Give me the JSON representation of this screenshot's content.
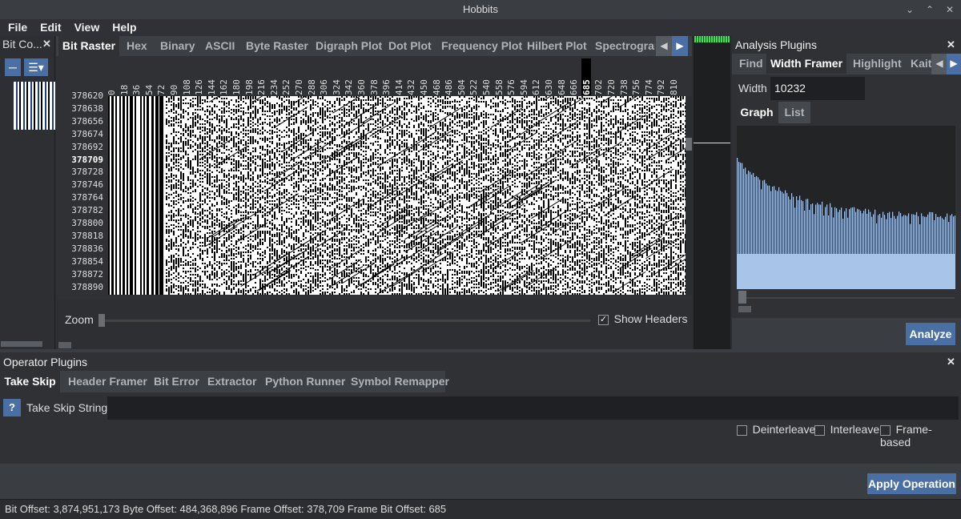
{
  "window": {
    "title": "Hobbits"
  },
  "menubar": {
    "items": [
      "File",
      "Edit",
      "View",
      "Help"
    ]
  },
  "left_panel": {
    "title": "Bit Co..."
  },
  "center": {
    "tabs": [
      "Bit Raster",
      "Hex",
      "Binary",
      "ASCII",
      "Byte Raster",
      "Digraph Plot",
      "Dot Plot",
      "Frequency Plot",
      "Hilbert Plot",
      "Spectrogram"
    ],
    "active_tab": "Bit Raster",
    "column_headers": [
      "0",
      "18",
      "36",
      "54",
      "72",
      "90",
      "108",
      "126",
      "144",
      "162",
      "180",
      "198",
      "216",
      "234",
      "252",
      "270",
      "288",
      "306",
      "324",
      "342",
      "360",
      "378",
      "396",
      "414",
      "432",
      "450",
      "468",
      "486",
      "504",
      "522",
      "540",
      "558",
      "576",
      "594",
      "612",
      "630",
      "648",
      "666",
      "685",
      "702",
      "720",
      "738",
      "756",
      "774",
      "792",
      "810"
    ],
    "highlighted_column": "685",
    "row_headers": [
      "378620",
      "378638",
      "378656",
      "378674",
      "378692",
      "378709",
      "378728",
      "378746",
      "378764",
      "378782",
      "378800",
      "378818",
      "378836",
      "378854",
      "378872",
      "378890"
    ],
    "highlighted_row": "378709",
    "zoom_label": "Zoom",
    "show_headers_label": "Show Headers",
    "show_headers_checked": true
  },
  "analysis": {
    "title": "Analysis Plugins",
    "tabs": [
      "Find",
      "Width Framer",
      "Highlight",
      "Kait"
    ],
    "active_tab": "Width Framer",
    "width_label": "Width",
    "width_value": "10232",
    "subtabs": [
      "Graph",
      "List"
    ],
    "active_subtab": "Graph",
    "analyze_label": "Analyze"
  },
  "operator": {
    "title": "Operator Plugins",
    "tabs": [
      "Take Skip",
      "Header Framer",
      "Bit Error",
      "Extractor",
      "Python Runner",
      "Symbol Remapper"
    ],
    "active_tab": "Take Skip",
    "help_label": "?",
    "take_skip_label": "Take Skip String",
    "take_skip_value": "",
    "options": [
      "Deinterleave",
      "Interleave",
      "Frame-based"
    ],
    "apply_label": "Apply Operation"
  },
  "status": {
    "text": "Bit Offset: 3,874,951,173  Byte Offset: 484,368,896  Frame Offset: 378,709  Frame Bit Offset: 685"
  },
  "colors": {
    "accent": "#4a6fa5",
    "graph_fill": "#a8c4e8",
    "minimap_highlight": "#3fe05a"
  }
}
